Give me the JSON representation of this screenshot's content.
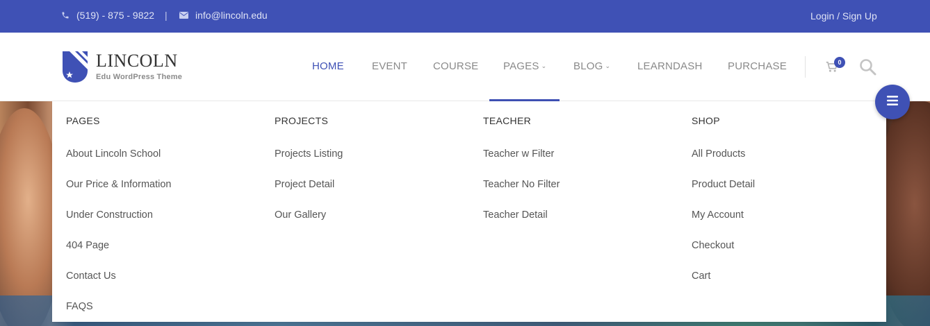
{
  "topbar": {
    "phone": "(519) - 875 - 9822",
    "separator": "|",
    "email": "info@lincoln.edu",
    "login": "Login / Sign Up"
  },
  "logo": {
    "title": "LINCOLN",
    "subtitle": "Edu WordPress Theme"
  },
  "nav": {
    "items": [
      {
        "label": "HOME",
        "active": true
      },
      {
        "label": "EVENT"
      },
      {
        "label": "COURSE"
      },
      {
        "label": "PAGES",
        "dropdown": true
      },
      {
        "label": "BLOG",
        "dropdown": true
      },
      {
        "label": "LEARNDASH"
      },
      {
        "label": "PURCHASE"
      }
    ],
    "chevron": "⌄",
    "cart_count": "0"
  },
  "mega_menu": {
    "columns": [
      {
        "title": "PAGES",
        "links": [
          "About Lincoln School",
          "Our Price & Information",
          "Under Construction",
          "404 Page",
          "Contact Us",
          "FAQS"
        ]
      },
      {
        "title": "PROJECTS",
        "links": [
          "Projects Listing",
          "Project Detail",
          "Our Gallery"
        ]
      },
      {
        "title": "TEACHER",
        "links": [
          "Teacher w Filter",
          "Teacher No Filter",
          "Teacher Detail"
        ]
      },
      {
        "title": "SHOP",
        "links": [
          "All Products",
          "Product Detail",
          "My Account",
          "Checkout",
          "Cart"
        ]
      }
    ]
  },
  "colors": {
    "brand": "#3f51b5",
    "nav_text": "#8a8a8a",
    "menu_text": "#555555"
  },
  "icons": {
    "phone": "phone-icon",
    "email": "mail-icon",
    "cart": "cart-icon",
    "search": "search-icon",
    "menu": "hamburger-icon",
    "logo": "shield-logo-icon"
  }
}
